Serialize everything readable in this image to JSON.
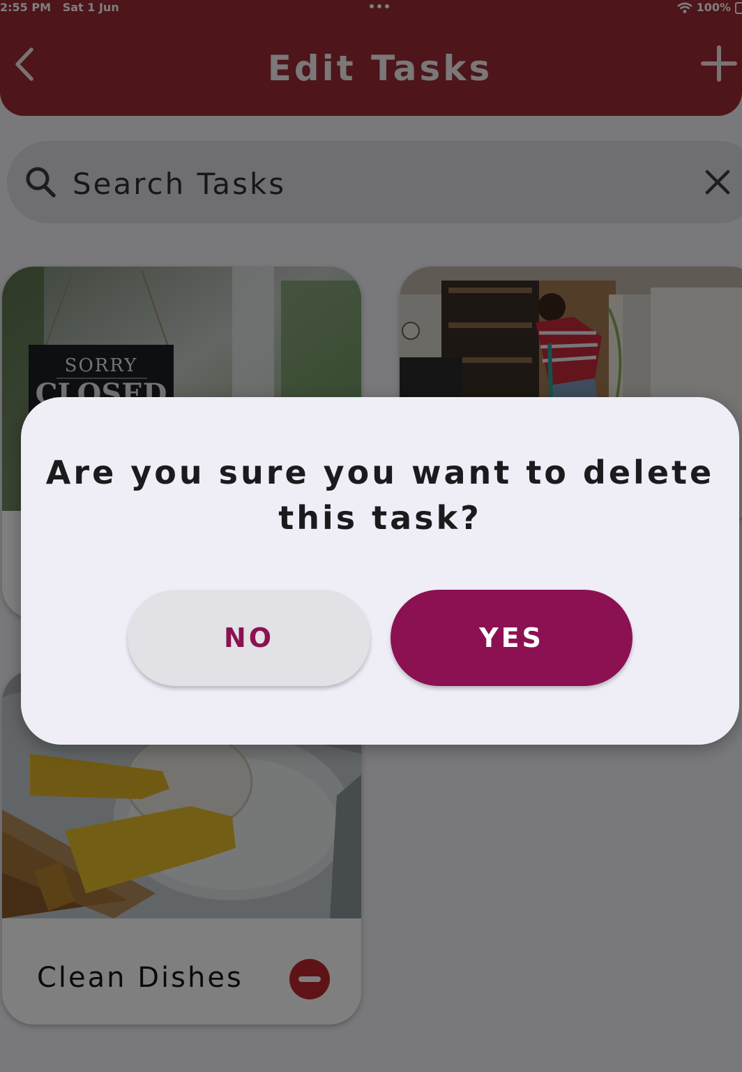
{
  "status_bar": {
    "time": "2:55 PM",
    "date": "Sat 1 Jun",
    "battery": "100%"
  },
  "header": {
    "title": "Edit Tasks",
    "back_icon": "chevron-left-icon",
    "add_icon": "plus-icon"
  },
  "search": {
    "placeholder": "Search Tasks",
    "value": "",
    "search_icon": "search-icon",
    "clear_icon": "close-icon"
  },
  "tasks": [
    {
      "label": "",
      "image": "sorry-we-are-closed-sign"
    },
    {
      "label": "",
      "image": "woman-mopping-kitchen"
    },
    {
      "label": "Clean Dishes",
      "image": "gloved-hands-washing-plate"
    }
  ],
  "sign": {
    "line1": "SORRY",
    "line2": "CLOSED"
  },
  "dialog": {
    "message": "Are you sure you want to delete this task?",
    "no_label": "NO",
    "yes_label": "YES"
  },
  "colors": {
    "header": "#9d2a35",
    "accent": "#8b1152",
    "delete": "#c0262d",
    "dialog_bg": "#efedf6"
  }
}
